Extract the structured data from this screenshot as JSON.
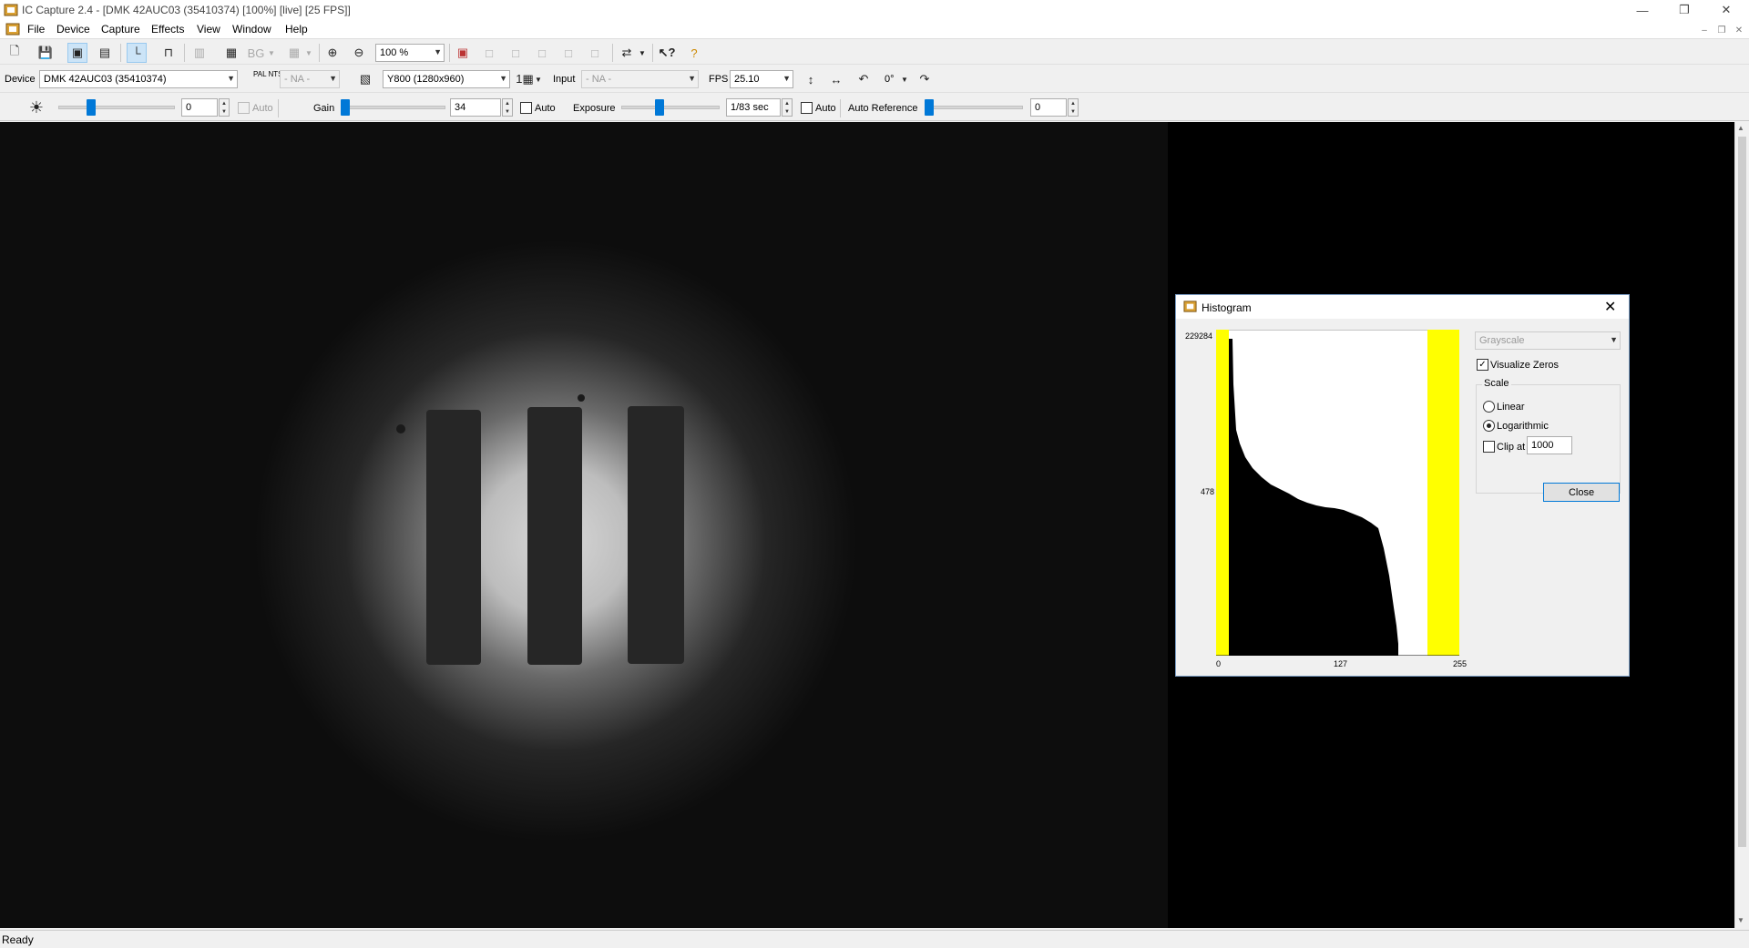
{
  "window": {
    "title": "IC Capture 2.4 - [DMK 42AUC03 (35410374) [100%]  [live]  [25 FPS]]"
  },
  "menu": {
    "items": [
      "File",
      "Device",
      "Capture",
      "Effects",
      "View",
      "Window",
      "Help"
    ]
  },
  "toolbar": {
    "zoom_value": "100 %"
  },
  "device_bar": {
    "device_label": "Device",
    "device_value": "DMK 42AUC03 (35410374)",
    "pal_ntsc_label": "PAL NTSC",
    "video_norm_value": "- NA -",
    "format_value": "Y800 (1280x960)",
    "input_label": "Input",
    "input_value": "- NA -",
    "fps_label": "FPS",
    "fps_value": "25.10",
    "rotation_value": "0°"
  },
  "properties_bar": {
    "brightness_value": "0",
    "brightness_auto_label": "Auto",
    "gain_label": "Gain",
    "gain_value": "34",
    "gain_auto_label": "Auto",
    "exposure_label": "Exposure",
    "exposure_value": "1/83 sec",
    "exposure_auto_label": "Auto",
    "auto_reference_label": "Auto Reference",
    "auto_reference_value": "0"
  },
  "status": {
    "text": "Ready"
  },
  "histogram_dialog": {
    "title": "Histogram",
    "channel_value": "Grayscale",
    "visualize_zeros_label": "Visualize Zeros",
    "visualize_zeros_checked": true,
    "scale_group_label": "Scale",
    "linear_label": "Linear",
    "logarithmic_label": "Logarithmic",
    "scale_selected": "Logarithmic",
    "clip_label": "Clip at",
    "clip_checked": false,
    "clip_value": "1000",
    "close_label": "Close",
    "y_max_label": "229284",
    "y_mid_label": "478",
    "x_labels": [
      "0",
      "127",
      "255"
    ],
    "highlight_color": "#ffff00"
  }
}
